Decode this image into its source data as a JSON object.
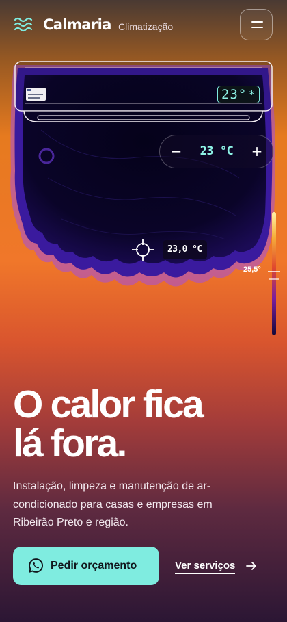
{
  "header": {
    "logo_icon": "waves-icon",
    "brand": "Calmaria",
    "subtitle": "Climatização",
    "menu_icon": "menu-icon"
  },
  "ac_unit": {
    "display_temp": "23°",
    "display_symbol": "*"
  },
  "thermostat": {
    "minus": "−",
    "value": "23 °C",
    "plus": "+"
  },
  "thermal": {
    "probe_reading": "23,0 °C",
    "scale_marker": "25,5°"
  },
  "hero": {
    "headline_line1": "O calor fica",
    "headline_line2": "lá fora.",
    "description": "Instalação, limpeza e manutenção de ar-condicionado para casas e empresas em Ribeirão Preto e região.",
    "primary_cta": "Pedir orçamento",
    "primary_icon": "whatsapp-icon",
    "secondary_cta": "Ver serviços",
    "secondary_icon": "arrow-right-icon"
  },
  "colors": {
    "accent": "#7fece0",
    "hot": "#f07a25",
    "cold": "#2c1470",
    "deep_cold": "#06021a"
  }
}
